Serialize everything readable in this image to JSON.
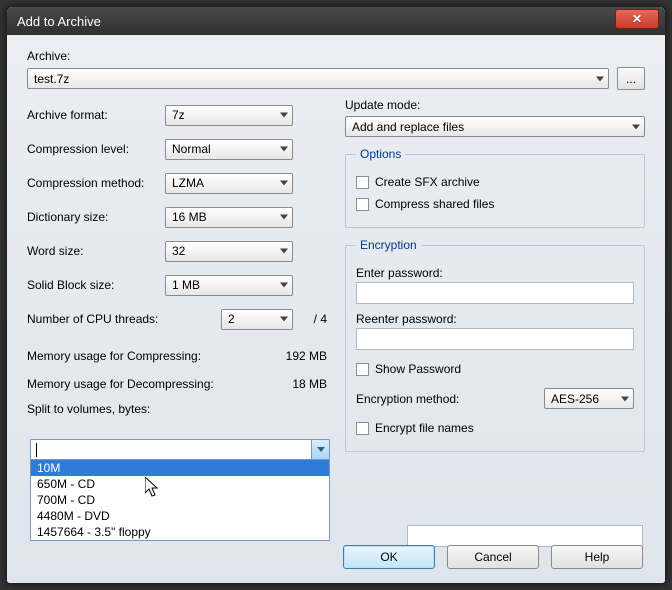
{
  "window": {
    "title": "Add to Archive"
  },
  "archive": {
    "label": "Archive:",
    "value": "test.7z",
    "browse": "..."
  },
  "left": {
    "format": {
      "label": "Archive format:",
      "value": "7z"
    },
    "level": {
      "label": "Compression level:",
      "value": "Normal"
    },
    "method": {
      "label": "Compression method:",
      "value": "LZMA"
    },
    "dict": {
      "label": "Dictionary size:",
      "value": "16 MB"
    },
    "word": {
      "label": "Word size:",
      "value": "32"
    },
    "block": {
      "label": "Solid Block size:",
      "value": "1 MB"
    },
    "threads": {
      "label": "Number of CPU threads:",
      "value": "2",
      "max": "/ 4"
    },
    "mem_comp": {
      "label": "Memory usage for Compressing:",
      "value": "192 MB"
    },
    "mem_decomp": {
      "label": "Memory usage for Decompressing:",
      "value": "18 MB"
    },
    "split": {
      "label": "Split to volumes, bytes:",
      "value": ""
    },
    "split_options": [
      "10M",
      "650M - CD",
      "700M - CD",
      "4480M - DVD",
      "1457664 - 3.5\" floppy"
    ]
  },
  "right": {
    "update": {
      "label": "Update mode:",
      "value": "Add and replace files"
    },
    "options": {
      "legend": "Options",
      "sfx": "Create SFX archive",
      "shared": "Compress shared files"
    },
    "encryption": {
      "legend": "Encryption",
      "enter": "Enter password:",
      "reenter": "Reenter password:",
      "show": "Show Password",
      "method_label": "Encryption method:",
      "method_value": "AES-256",
      "encrypt_names": "Encrypt file names"
    }
  },
  "buttons": {
    "ok": "OK",
    "cancel": "Cancel",
    "help": "Help"
  }
}
